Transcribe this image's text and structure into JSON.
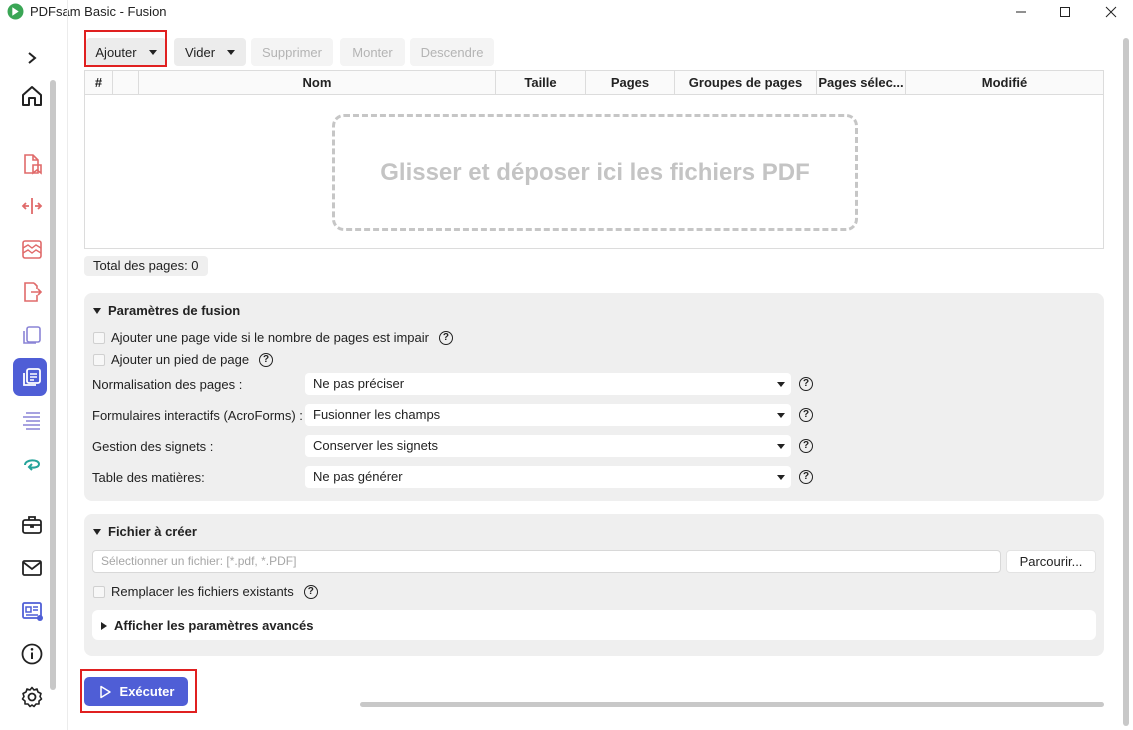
{
  "window": {
    "title": "PDFsam Basic - Fusion",
    "minimize_icon": "minimize-icon",
    "maximize_icon": "maximize-icon",
    "close_icon": "close-icon"
  },
  "sidebar": {
    "items": [
      {
        "name": "expand-icon"
      },
      {
        "name": "home-icon"
      },
      {
        "name": "split-by-bookmarks-icon",
        "color": "#e06a6a"
      },
      {
        "name": "split-icon",
        "color": "#e06a6a"
      },
      {
        "name": "split-by-size-icon",
        "color": "#e06a6a"
      },
      {
        "name": "extract-icon",
        "color": "#e06a6a"
      },
      {
        "name": "rotate-icon",
        "color": "#8a84d6"
      },
      {
        "name": "merge-icon",
        "color": "#4f5ed6",
        "active": true
      },
      {
        "name": "alternate-mix-icon",
        "color": "#8a84d6"
      },
      {
        "name": "rotate-arrow-icon",
        "color": "#25a39a"
      },
      {
        "name": "toolbox-icon"
      },
      {
        "name": "news-icon"
      },
      {
        "name": "dashboard-icon"
      },
      {
        "name": "info-icon"
      },
      {
        "name": "settings-icon"
      }
    ]
  },
  "toolbar": {
    "add_label": "Ajouter",
    "clear_label": "Vider",
    "remove_label": "Supprimer",
    "move_up_label": "Monter",
    "move_down_label": "Descendre"
  },
  "table": {
    "columns": [
      "#",
      "",
      "Nom",
      "Taille",
      "Pages",
      "Groupes de pages",
      "Pages sélec...",
      "Modifié"
    ],
    "dropzone_text": "Glisser et déposer ici les fichiers PDF",
    "rows": []
  },
  "total_pages": "Total des pages: 0",
  "merge_settings": {
    "title": "Paramètres de fusion",
    "checkbox_blank_page": "Ajouter une page vide si le nombre de pages est impair",
    "checkbox_footer": "Ajouter un pied de page",
    "normalize_label": "Normalisation des pages :",
    "normalize_value": "Ne pas préciser",
    "forms_label": "Formulaires interactifs (AcroForms) :",
    "forms_value": "Fusionner les champs",
    "bookmarks_label": "Gestion des signets :",
    "bookmarks_value": "Conserver les signets",
    "toc_label": "Table des matières:",
    "toc_value": "Ne pas générer"
  },
  "output": {
    "title": "Fichier à créer",
    "file_placeholder": "Sélectionner un fichier: [*.pdf, *.PDF]",
    "browse_label": "Parcourir...",
    "overwrite_label": "Remplacer les fichiers existants",
    "advanced_label": "Afficher les paramètres avancés"
  },
  "run_label": "Exécuter",
  "colors": {
    "accent": "#4f5ed6",
    "highlight": "#e02020"
  }
}
